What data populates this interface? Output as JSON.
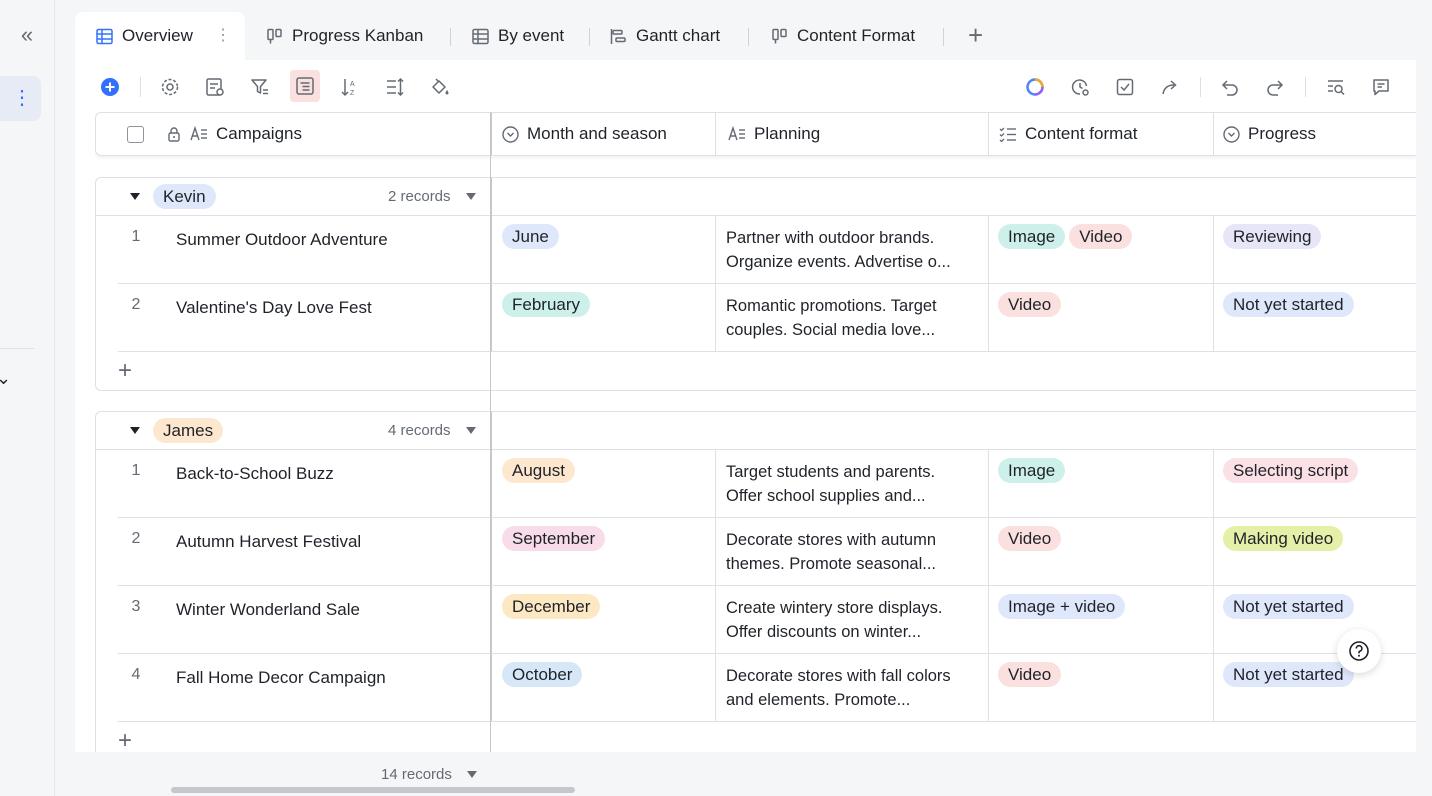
{
  "tabs": [
    {
      "label": "Overview",
      "icon": "grid-table-icon"
    },
    {
      "label": "Progress Kanban",
      "icon": "kanban-icon"
    },
    {
      "label": "By event",
      "icon": "grid-table-icon"
    },
    {
      "label": "Gantt chart",
      "icon": "gantt-icon"
    },
    {
      "label": "Content Format",
      "icon": "kanban-icon"
    }
  ],
  "columns": {
    "campaigns": "Campaigns",
    "month": "Month and season",
    "planning": "Planning",
    "content": "Content format",
    "progress": "Progress"
  },
  "groups": [
    {
      "name": "Kevin",
      "count": "2 records",
      "rows": [
        {
          "num": "1",
          "campaign": "Summer Outdoor Adventure",
          "month": "June",
          "planning1": "Partner with outdoor brands.",
          "planning2": "Organize events. Advertise o...",
          "formats": [
            "Image",
            "Video"
          ],
          "progress": "Reviewing"
        },
        {
          "num": "2",
          "campaign": "Valentine's Day Love Fest",
          "month": "February",
          "planning1": "Romantic promotions. Target",
          "planning2": "couples. Social media love...",
          "formats": [
            "Video"
          ],
          "progress": "Not yet started"
        }
      ]
    },
    {
      "name": "James",
      "count": "4 records",
      "rows": [
        {
          "num": "1",
          "campaign": "Back-to-School Buzz",
          "month": "August",
          "planning1": "Target students and parents.",
          "planning2": "Offer school supplies and...",
          "formats": [
            "Image"
          ],
          "progress": "Selecting script"
        },
        {
          "num": "2",
          "campaign": "Autumn Harvest Festival",
          "month": "September",
          "planning1": "Decorate stores with autumn",
          "planning2": "themes. Promote seasonal...",
          "formats": [
            "Video"
          ],
          "progress": "Making video"
        },
        {
          "num": "3",
          "campaign": "Winter Wonderland Sale",
          "month": "December",
          "planning1": "Create wintery store displays.",
          "planning2": "Offer discounts on winter...",
          "formats": [
            "Image + video"
          ],
          "progress": "Not yet started"
        },
        {
          "num": "4",
          "campaign": "Fall Home Decor Campaign",
          "month": "October",
          "planning1": "Decorate stores with fall colors",
          "planning2": "and elements. Promote...",
          "formats": [
            "Video"
          ],
          "progress": "Not yet started"
        }
      ]
    }
  ],
  "footer": {
    "total": "14 records"
  },
  "colors": {
    "accent": "#3370ff",
    "Kevin": "#dfe7fb",
    "James": "#fde7cf",
    "June": "#dfe7fb",
    "February": "#cdf0ea",
    "August": "#fde7cf",
    "September": "#f9dcea",
    "December": "#fde8c4",
    "October": "#d6e8f8",
    "Image": "#cdf0ea",
    "Video": "#fbe0e0",
    "Image + video": "#dfe7fb",
    "Reviewing": "#e6e6f8",
    "Not yet started": "#dfe7fb",
    "Selecting script": "#fbe0e6",
    "Making video": "#e6efa8"
  }
}
